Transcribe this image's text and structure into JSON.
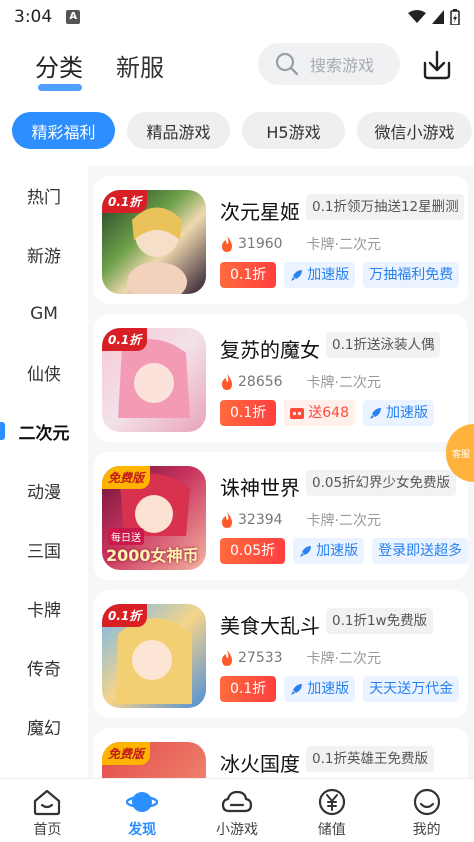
{
  "status": {
    "time": "3:04",
    "notif_letter": "A"
  },
  "header": {
    "tabs": [
      "分类",
      "新服"
    ],
    "search_placeholder": "搜索游戏"
  },
  "pills": [
    "精彩福利",
    "精品游戏",
    "H5游戏",
    "微信小游戏"
  ],
  "sidebar": [
    "热门",
    "新游",
    "GM",
    "仙侠",
    "二次元",
    "动漫",
    "三国",
    "卡牌",
    "传奇",
    "魔幻"
  ],
  "games": [
    {
      "name": "次元星姬",
      "tag": "0.1折领万抽送12星删测",
      "hot": "31960",
      "category": "卡牌·二次元",
      "discount": "0.1折",
      "speed": "加速版",
      "gift": "",
      "extra": "万抽福利免费",
      "badge": "0.1折"
    },
    {
      "name": "复苏的魔女",
      "tag": "0.1折送泳装人偶",
      "hot": "28656",
      "category": "卡牌·二次元",
      "discount": "0.1折",
      "speed": "加速版",
      "gift": "送648",
      "extra": "",
      "badge": "0.1折"
    },
    {
      "name": "诛神世界",
      "tag": "0.05折幻界少女免费版",
      "hot": "32394",
      "category": "卡牌·二次元",
      "discount": "0.05折",
      "speed": "加速版",
      "gift": "",
      "extra": "登录即送超多",
      "badge": "免费版"
    },
    {
      "name": "美食大乱斗",
      "tag": "0.1折1w免费版",
      "hot": "27533",
      "category": "卡牌·二次元",
      "discount": "0.1折",
      "speed": "加速版",
      "gift": "",
      "extra": "天天送万代金",
      "badge": "0.1折"
    },
    {
      "name": "冰火国度",
      "tag": "0.1折英雄王免费版",
      "hot": "",
      "category": "",
      "discount": "",
      "speed": "",
      "gift": "",
      "extra": "",
      "badge": "免费版"
    }
  ],
  "thumb_texts": {
    "game3_overlay": "2000女神币",
    "game3_small": "每日送"
  },
  "float_label": "客服",
  "nav": [
    "首页",
    "发现",
    "小游戏",
    "储值",
    "我的"
  ],
  "colors": {
    "accent": "#2c8eff",
    "discount": "#ff4a3a",
    "hot": "#ff5a2a"
  }
}
